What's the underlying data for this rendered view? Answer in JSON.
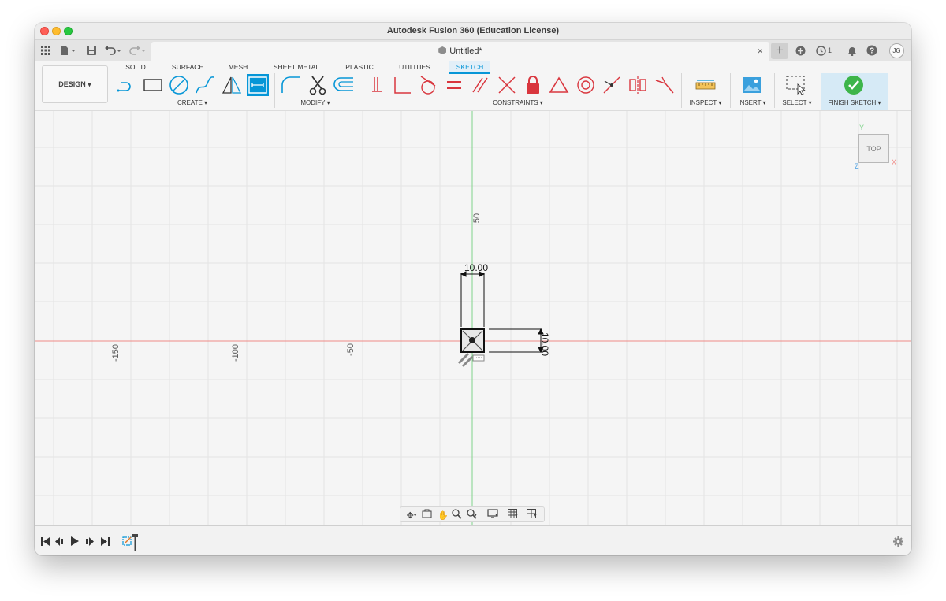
{
  "window": {
    "title": "Autodesk Fusion 360 (Education License)"
  },
  "tabbar": {
    "document_name": "Untitled*",
    "job_count": "1",
    "user_initials": "JG"
  },
  "toolbar": {
    "workspace_label": "DESIGN",
    "tabs": [
      {
        "label": "SOLID",
        "active": false
      },
      {
        "label": "SURFACE",
        "active": false
      },
      {
        "label": "MESH",
        "active": false
      },
      {
        "label": "SHEET METAL",
        "active": false
      },
      {
        "label": "PLASTIC",
        "active": false
      },
      {
        "label": "UTILITIES",
        "active": false
      },
      {
        "label": "SKETCH",
        "active": true
      }
    ],
    "groups": {
      "create": "CREATE",
      "modify": "MODIFY",
      "constraints": "CONSTRAINTS",
      "inspect": "INSPECT",
      "insert": "INSERT",
      "select": "SELECT",
      "finish": "FINISH SKETCH"
    },
    "accent_color": "#0696d7",
    "constraint_color": "#d9363e",
    "finish_color": "#3db54a"
  },
  "canvas": {
    "axis_labels": {
      "y_50": "50",
      "x_neg150": "-150",
      "x_neg100": "-100",
      "x_neg50": "-50"
    },
    "dimensions": {
      "width": "10.00",
      "height": "10.00"
    },
    "viewcube": {
      "face": "TOP",
      "x": "X",
      "y": "Y",
      "z": "Z"
    },
    "x_axis_color": "#f08a86",
    "y_axis_color": "#7fd38a"
  }
}
